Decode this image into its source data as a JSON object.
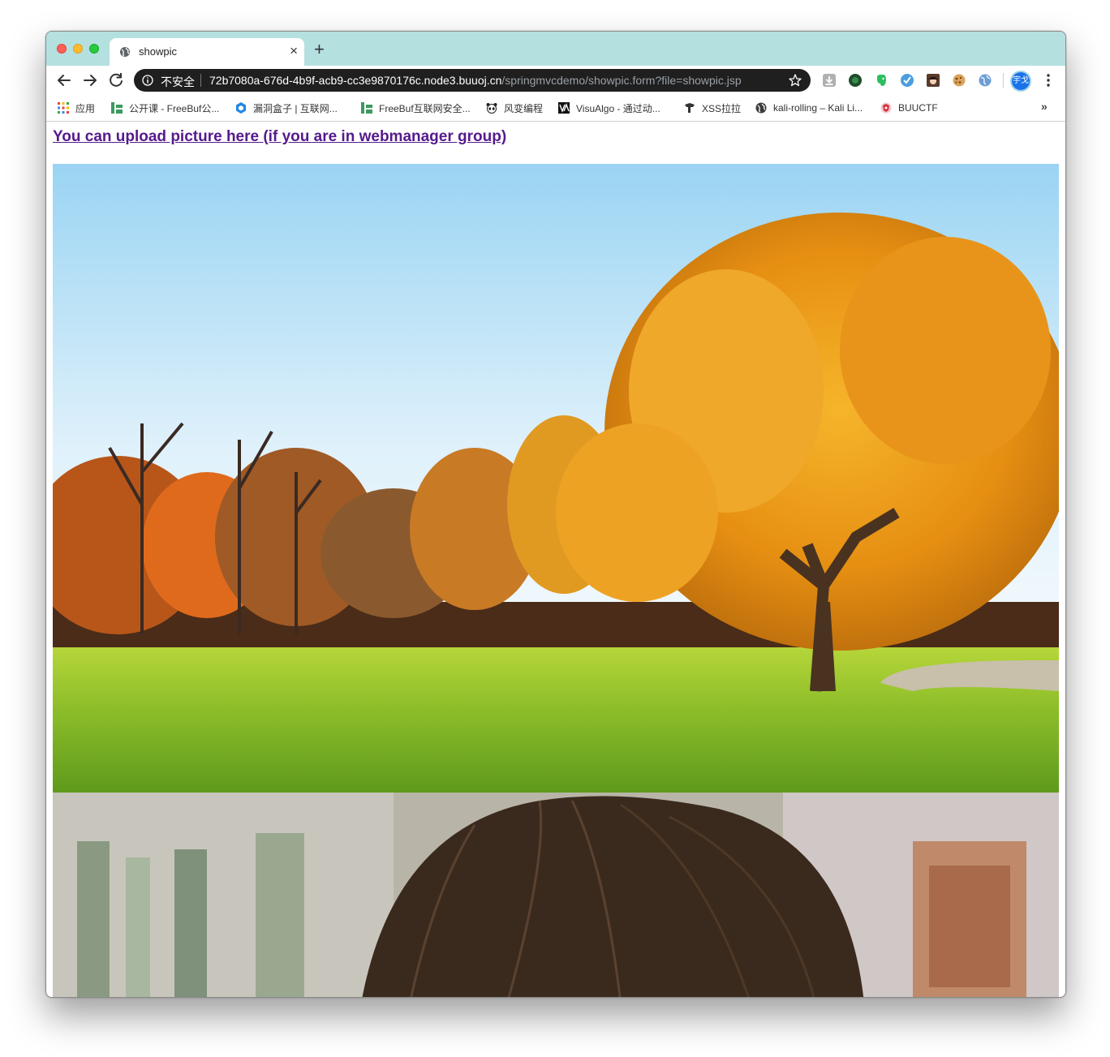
{
  "tab": {
    "title": "showpic",
    "close": "×",
    "new_tab": "+"
  },
  "omnibox": {
    "security_label": "不安全",
    "url_host": "72b7080a-676d-4b9f-acb9-cc3e9870176c.node3.buuoj.cn",
    "url_path": "/springmvcdemo/showpic.form?file=showpic.jsp"
  },
  "profile": {
    "avatar_text": "宇戈"
  },
  "bookmarks": {
    "items": [
      {
        "label": "应用",
        "icon": "apps-grid-icon"
      },
      {
        "label": "公开课 - FreeBuf公...",
        "icon": "freebuf-icon"
      },
      {
        "label": "漏洞盒子 | 互联网...",
        "icon": "vulbox-icon"
      },
      {
        "label": "FreeBuf互联网安全...",
        "icon": "freebuf-icon"
      },
      {
        "label": "风变编程",
        "icon": "panda-icon"
      },
      {
        "label": "VisuAlgo - 通过动...",
        "icon": "visualgo-icon"
      },
      {
        "label": "XSS拉拉",
        "icon": "xss-icon"
      },
      {
        "label": "kali-rolling – Kali Li...",
        "icon": "globe-icon"
      },
      {
        "label": "BUUCTF",
        "icon": "buuctf-icon"
      }
    ],
    "more": "»"
  },
  "page": {
    "upload_link": "You can upload picture here (if you are in webmanager group)"
  },
  "colors": {
    "tabstrip": "#b5e0e0",
    "omnibox": "#1f1f1f",
    "visited_link": "#551a8b",
    "avatar": "#1a73e8"
  }
}
